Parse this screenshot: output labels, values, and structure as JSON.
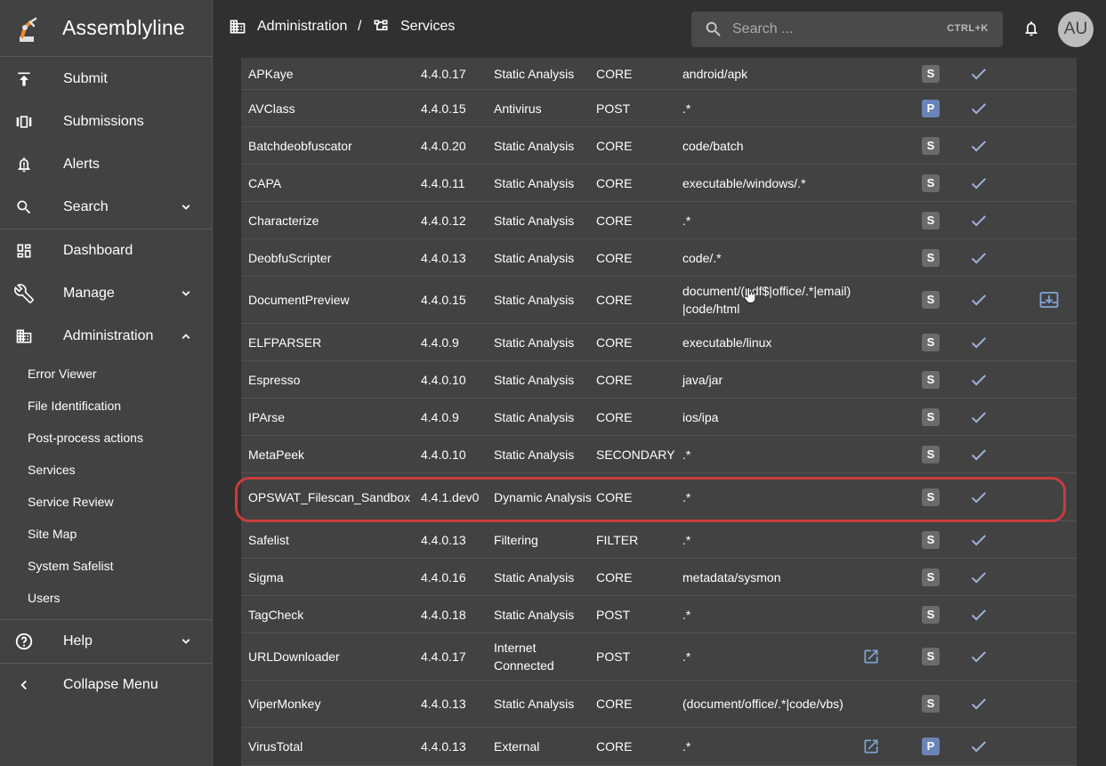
{
  "app": {
    "title": "Assemblyline"
  },
  "nav": {
    "submit": "Submit",
    "submissions": "Submissions",
    "alerts": "Alerts",
    "search": "Search",
    "dashboard": "Dashboard",
    "manage": "Manage",
    "administration": "Administration",
    "help": "Help",
    "collapse": "Collapse Menu"
  },
  "admin_items": [
    "Error Viewer",
    "File Identification",
    "Post-process actions",
    "Services",
    "Service Review",
    "Site Map",
    "System Safelist",
    "Users"
  ],
  "breadcrumb": {
    "first": "Administration",
    "separator": "/",
    "second": "Services"
  },
  "search": {
    "placeholder": "Search ...",
    "shortcut": "CTRL+K"
  },
  "user": {
    "initials": "AU"
  },
  "services": [
    {
      "name": "APKaye",
      "version": "4.4.0.17",
      "category": "Static Analysis",
      "stage": "CORE",
      "accepts": "android/apk",
      "badge": "S",
      "external": false,
      "download": false
    },
    {
      "name": "AVClass",
      "version": "4.4.0.15",
      "category": "Antivirus",
      "stage": "POST",
      "accepts": ".*",
      "badge": "P",
      "external": false,
      "download": false
    },
    {
      "name": "Batchdeobfuscator",
      "version": "4.4.0.20",
      "category": "Static Analysis",
      "stage": "CORE",
      "accepts": "code/batch",
      "badge": "S",
      "external": false,
      "download": false
    },
    {
      "name": "CAPA",
      "version": "4.4.0.11",
      "category": "Static Analysis",
      "stage": "CORE",
      "accepts": "executable/windows/.*",
      "badge": "S",
      "external": false,
      "download": false
    },
    {
      "name": "Characterize",
      "version": "4.4.0.12",
      "category": "Static Analysis",
      "stage": "CORE",
      "accepts": ".*",
      "badge": "S",
      "external": false,
      "download": false
    },
    {
      "name": "DeobfuScripter",
      "version": "4.4.0.13",
      "category": "Static Analysis",
      "stage": "CORE",
      "accepts": "code/.*",
      "badge": "S",
      "external": false,
      "download": false
    },
    {
      "name": "DocumentPreview",
      "version": "4.4.0.15",
      "category": "Static Analysis",
      "stage": "CORE",
      "accepts": "document/(pdf$|office/.*|email)|code/html",
      "badge": "S",
      "external": false,
      "download": true
    },
    {
      "name": "ELFPARSER",
      "version": "4.4.0.9",
      "category": "Static Analysis",
      "stage": "CORE",
      "accepts": "executable/linux",
      "badge": "S",
      "external": false,
      "download": false
    },
    {
      "name": "Espresso",
      "version": "4.4.0.10",
      "category": "Static Analysis",
      "stage": "CORE",
      "accepts": "java/jar",
      "badge": "S",
      "external": false,
      "download": false
    },
    {
      "name": "IPArse",
      "version": "4.4.0.9",
      "category": "Static Analysis",
      "stage": "CORE",
      "accepts": "ios/ipa",
      "badge": "S",
      "external": false,
      "download": false
    },
    {
      "name": "MetaPeek",
      "version": "4.4.0.10",
      "category": "Static Analysis",
      "stage": "SECONDARY",
      "accepts": ".*",
      "badge": "S",
      "external": false,
      "download": false
    },
    {
      "name": "OPSWAT_Filescan_Sandbox",
      "version": "4.4.1.dev0",
      "category": "Dynamic Analysis",
      "stage": "CORE",
      "accepts": ".*",
      "badge": "S",
      "external": false,
      "download": false
    },
    {
      "name": "Safelist",
      "version": "4.4.0.13",
      "category": "Filtering",
      "stage": "FILTER",
      "accepts": ".*",
      "badge": "S",
      "external": false,
      "download": false
    },
    {
      "name": "Sigma",
      "version": "4.4.0.16",
      "category": "Static Analysis",
      "stage": "CORE",
      "accepts": "metadata/sysmon",
      "badge": "S",
      "external": false,
      "download": false
    },
    {
      "name": "TagCheck",
      "version": "4.4.0.18",
      "category": "Static Analysis",
      "stage": "POST",
      "accepts": ".*",
      "badge": "S",
      "external": false,
      "download": false
    },
    {
      "name": "URLDownloader",
      "version": "4.4.0.17",
      "category": "Internet Connected",
      "stage": "POST",
      "accepts": ".*",
      "badge": "S",
      "external": true,
      "download": false
    },
    {
      "name": "ViperMonkey",
      "version": "4.4.0.13",
      "category": "Static Analysis",
      "stage": "CORE",
      "accepts": "(document/office/.*|code/vbs)",
      "badge": "S",
      "external": false,
      "download": false
    },
    {
      "name": "VirusTotal",
      "version": "4.4.0.13",
      "category": "External",
      "stage": "CORE",
      "accepts": ".*",
      "badge": "P",
      "external": true,
      "download": false
    }
  ],
  "colors": {
    "accent": "#c93c3c",
    "badge_s": "#6b6b6b",
    "badge_p": "#6a84b8",
    "link": "#7fa6d8"
  }
}
